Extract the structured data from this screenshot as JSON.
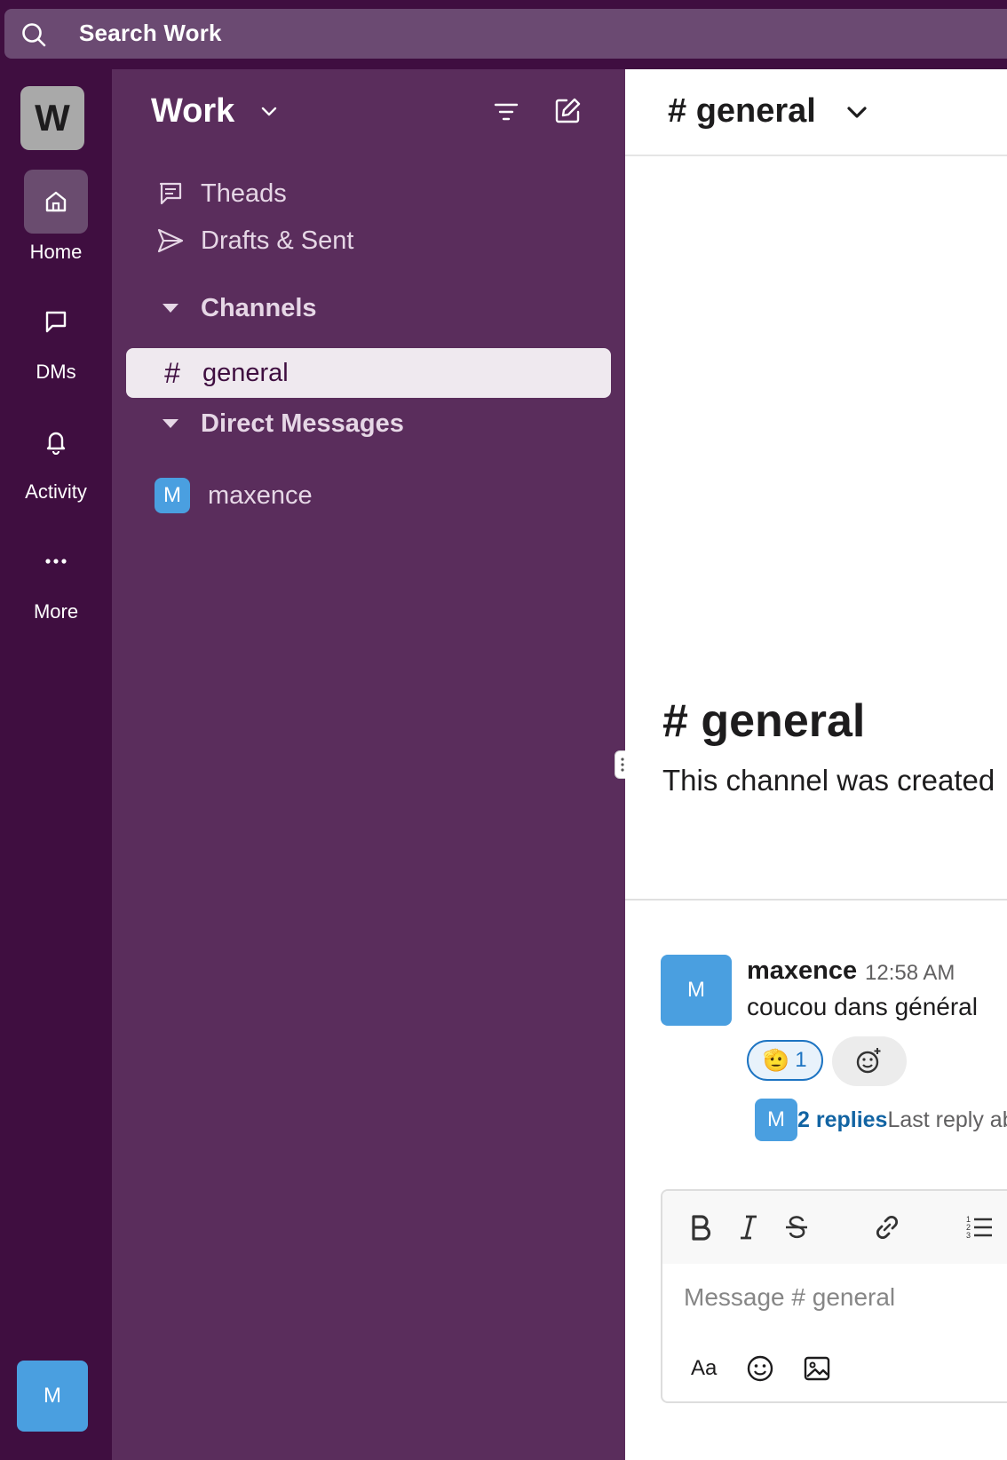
{
  "search": {
    "label": "Search Work"
  },
  "workspace": {
    "initial": "W",
    "name": "Work"
  },
  "rail": {
    "items": [
      {
        "label": "Home",
        "icon": "home-icon",
        "active": true
      },
      {
        "label": "DMs",
        "icon": "chat-bubble-icon",
        "active": false
      },
      {
        "label": "Activity",
        "icon": "bell-icon",
        "active": false
      },
      {
        "label": "More",
        "icon": "more-dots-icon",
        "active": false
      }
    ],
    "user_initial": "M"
  },
  "sidebar": {
    "nav": [
      {
        "label": "Theads",
        "icon": "threads-icon"
      },
      {
        "label": "Drafts & Sent",
        "icon": "send-icon"
      }
    ],
    "channels_header": "Channels",
    "channels": [
      {
        "hash": "#",
        "name": "general",
        "active": true
      }
    ],
    "dms_header": "Direct Messages",
    "dms": [
      {
        "initial": "M",
        "name": "maxence"
      }
    ]
  },
  "channel": {
    "header_title": "# general",
    "intro_title": "# general",
    "intro_text": "This channel was created"
  },
  "message": {
    "author_initial": "M",
    "author": "maxence",
    "time": "12:58 AM",
    "text": "coucou dans général",
    "reaction": {
      "emoji": "🫡",
      "count": "1"
    },
    "replies": {
      "initial": "M",
      "count_label": "2 replies",
      "last_label": "Last reply ab"
    }
  },
  "composer": {
    "placeholder": "Message # general",
    "format_label": "Aa",
    "toolbar": [
      "bold-icon",
      "italic-icon",
      "strikethrough-icon",
      "link-icon",
      "ordered-list-icon"
    ]
  },
  "colors": {
    "rail_bg": "#3f0e40",
    "sidebar_bg": "#5a2d5c",
    "accent_blue": "#1264a3",
    "avatar_blue": "#4a9fe0"
  }
}
